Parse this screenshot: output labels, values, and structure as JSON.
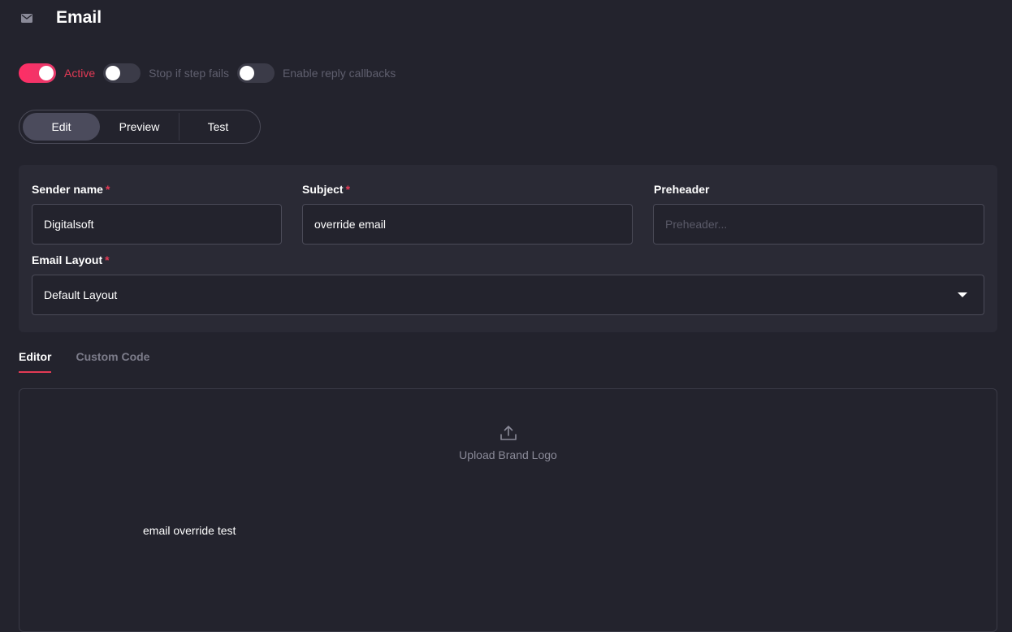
{
  "header": {
    "title": "Email",
    "icon": "mail-icon"
  },
  "toggles": [
    {
      "label": "Active",
      "on": true
    },
    {
      "label": "Stop if step fails",
      "on": false
    },
    {
      "label": "Enable reply callbacks",
      "on": false
    }
  ],
  "mode_tabs": {
    "edit": "Edit",
    "preview": "Preview",
    "test": "Test",
    "selected": "Edit"
  },
  "form": {
    "sender_name": {
      "label": "Sender name",
      "required": "*",
      "value": "Digitalsoft"
    },
    "subject": {
      "label": "Subject",
      "required": "*",
      "value": "override email"
    },
    "preheader": {
      "label": "Preheader",
      "placeholder": "Preheader..."
    },
    "email_layout": {
      "label": "Email Layout",
      "required": "*",
      "value": "Default Layout"
    }
  },
  "editor_tabs": {
    "editor": "Editor",
    "custom_code": "Custom Code",
    "selected": "Editor"
  },
  "editor": {
    "upload_label": "Upload Brand Logo",
    "content": "email override test"
  },
  "colors": {
    "accent": "#e33a55",
    "background": "#23232d",
    "card": "#2a2a35"
  }
}
